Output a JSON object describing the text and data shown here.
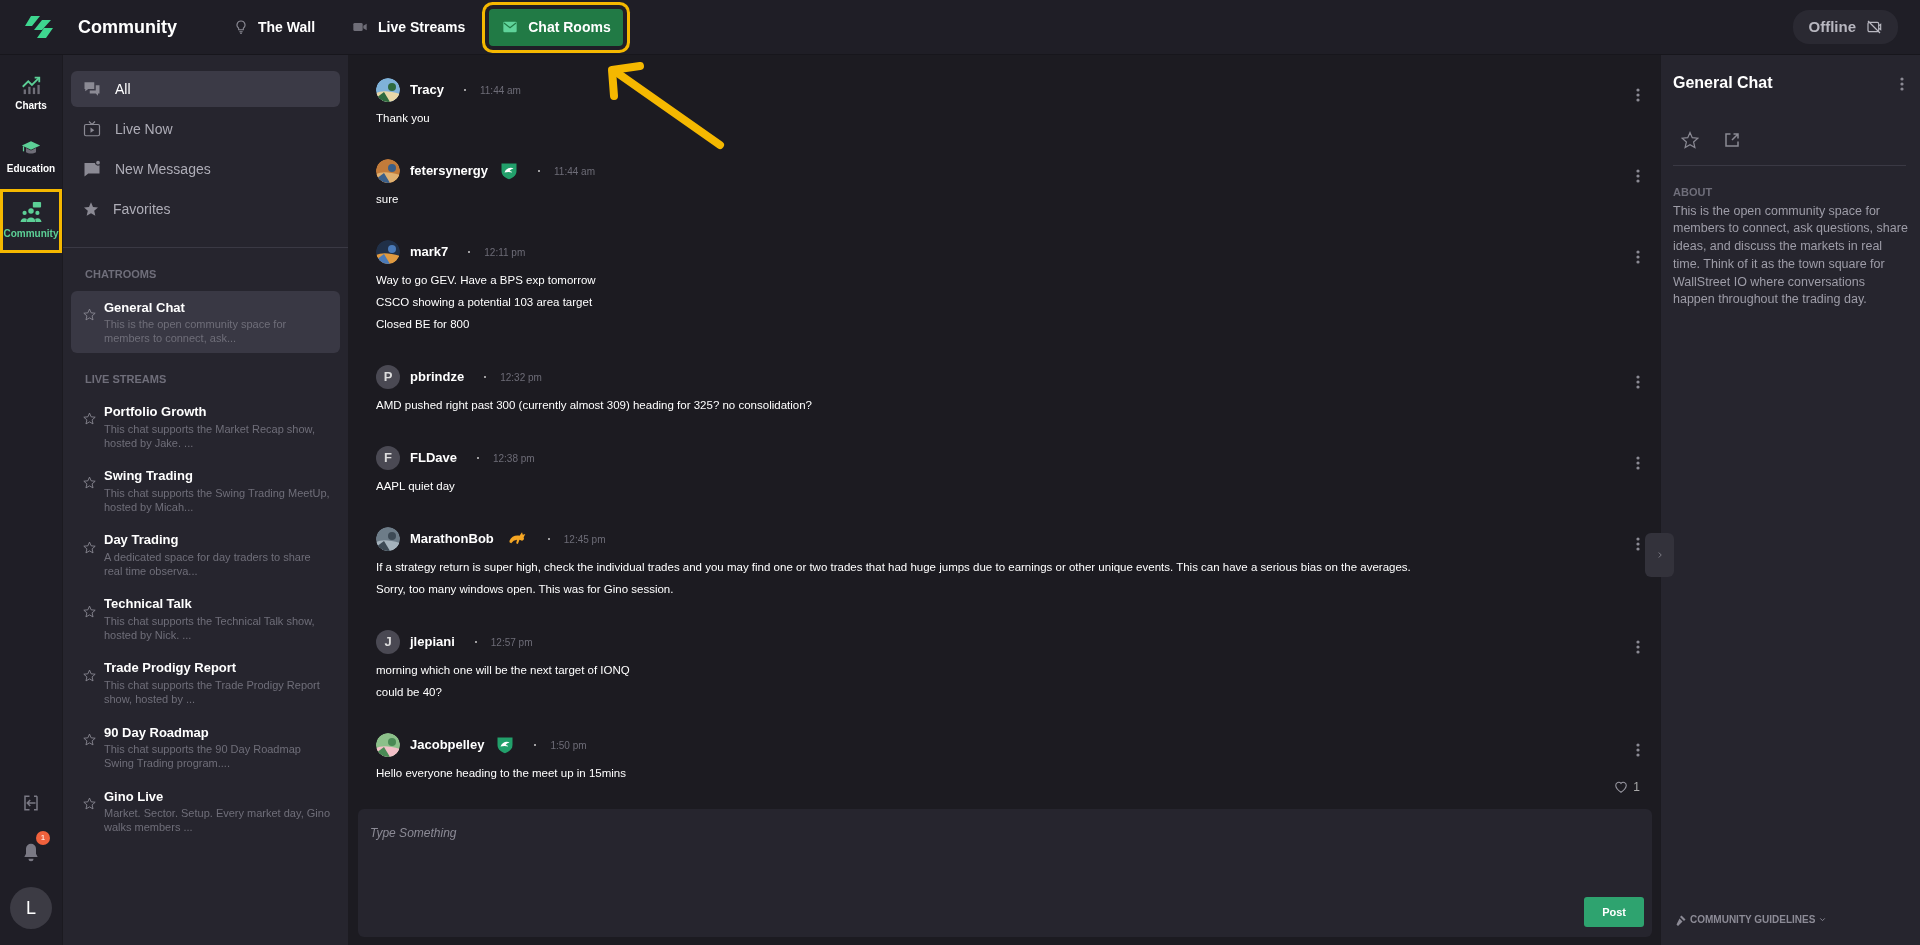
{
  "header": {
    "title": "Community",
    "tabs": [
      {
        "label": "The Wall",
        "selected": false,
        "highlighted": false
      },
      {
        "label": "Live Streams",
        "selected": false,
        "highlighted": false
      },
      {
        "label": "Chat Rooms",
        "selected": true,
        "highlighted": true
      }
    ],
    "status": {
      "label": "Offline",
      "online": false
    }
  },
  "rail": {
    "items": [
      {
        "label": "Charts",
        "selected": false,
        "highlighted": false
      },
      {
        "label": "Education",
        "selected": false,
        "highlighted": false
      },
      {
        "label": "Community",
        "selected": true,
        "highlighted": true
      }
    ],
    "notifications": "1",
    "user_initial": "L"
  },
  "sidebar": {
    "filters": [
      {
        "label": "All",
        "selected": true
      },
      {
        "label": "Live Now",
        "selected": false
      },
      {
        "label": "New Messages",
        "selected": false
      },
      {
        "label": "Favorites",
        "selected": false
      }
    ],
    "sections": [
      {
        "title": "CHATROOMS",
        "rooms": [
          {
            "name": "General Chat",
            "description": "This is the open community space for members to connect, ask...",
            "selected": true,
            "favorite": false
          }
        ]
      },
      {
        "title": "LIVE STREAMS",
        "rooms": [
          {
            "name": "Portfolio Growth",
            "description": "This chat supports the Market Recap show, hosted by Jake. ...",
            "selected": false,
            "favorite": false
          },
          {
            "name": "Swing Trading",
            "description": "This chat supports the Swing Trading MeetUp, hosted by Micah...",
            "selected": false,
            "favorite": false
          },
          {
            "name": "Day Trading",
            "description": "A dedicated space for day traders to share real time observa...",
            "selected": false,
            "favorite": false
          },
          {
            "name": "Technical Talk",
            "description": "This chat supports the Technical Talk show, hosted by Nick. ...",
            "selected": false,
            "favorite": false
          },
          {
            "name": "Trade Prodigy Report",
            "description": "This chat supports the Trade Prodigy Report show, hosted by ...",
            "selected": false,
            "favorite": false
          },
          {
            "name": "90 Day Roadmap",
            "description": "This chat supports the 90 Day Roadmap Swing Trading program....",
            "selected": false,
            "favorite": false
          },
          {
            "name": "Gino Live",
            "description": "Market. Sector. Setup. Every market day, Gino walks members ...",
            "selected": false,
            "favorite": false
          }
        ]
      }
    ]
  },
  "messages": [
    {
      "author": "Tracy",
      "avatar": {
        "kind": "picture"
      },
      "time": "11:44 am",
      "lines": [
        "Thank you"
      ]
    },
    {
      "author": "fetersynergy",
      "avatar": {
        "kind": "picture"
      },
      "badge": {
        "kind": "shield"
      },
      "time": "11:44 am",
      "lines": [
        "sure"
      ]
    },
    {
      "author": "mark7",
      "avatar": {
        "kind": "picture"
      },
      "time": "12:11 pm",
      "lines": [
        "Way to go GEV. Have a BPS exp tomorrow",
        "CSCO showing a potential 103 area target",
        "Closed BE for 800"
      ]
    },
    {
      "author": "pbrindze",
      "avatar": {
        "kind": "initial",
        "initial": "P"
      },
      "time": "12:32 pm",
      "lines": [
        "AMD pushed right past 300 (currently almost 309) heading for 325? no consolidation?"
      ]
    },
    {
      "author": "FLDave",
      "avatar": {
        "kind": "initial",
        "initial": "F"
      },
      "time": "12:38 pm",
      "lines": [
        "AAPL  quiet day"
      ]
    },
    {
      "author": "MarathonBob",
      "avatar": {
        "kind": "picture"
      },
      "badge": {
        "kind": "bull"
      },
      "time": "12:45 pm",
      "lines": [
        "If a strategy return is super high, check the individual trades and you may find one or two trades that had huge jumps due to earnings or other unique events.  This can have a serious bias on the averages.",
        "Sorry, too many windows open.  This was for Gino session."
      ]
    },
    {
      "author": "jlepiani",
      "avatar": {
        "kind": "initial",
        "initial": "J"
      },
      "time": "12:57 pm",
      "lines": [
        "morning which one will be the next target of IONQ",
        "could be 40?"
      ]
    },
    {
      "author": "Jacobpelley",
      "avatar": {
        "kind": "picture"
      },
      "badge": {
        "kind": "shield"
      },
      "time": "1:50 pm",
      "lines": [
        "Hello everyone heading to the meet up in 15mins"
      ],
      "likes": "1"
    }
  ],
  "composer": {
    "placeholder": "Type Something",
    "button": "Post"
  },
  "details": {
    "title": "General Chat",
    "about_heading": "ABOUT",
    "about": "This is the open community space for members to connect, ask questions, share ideas, and discuss the markets in real time. Think of it as the town square for WallStreet IO where conversations happen throughout the trading day.",
    "footer": "COMMUNITY GUIDELINES"
  }
}
